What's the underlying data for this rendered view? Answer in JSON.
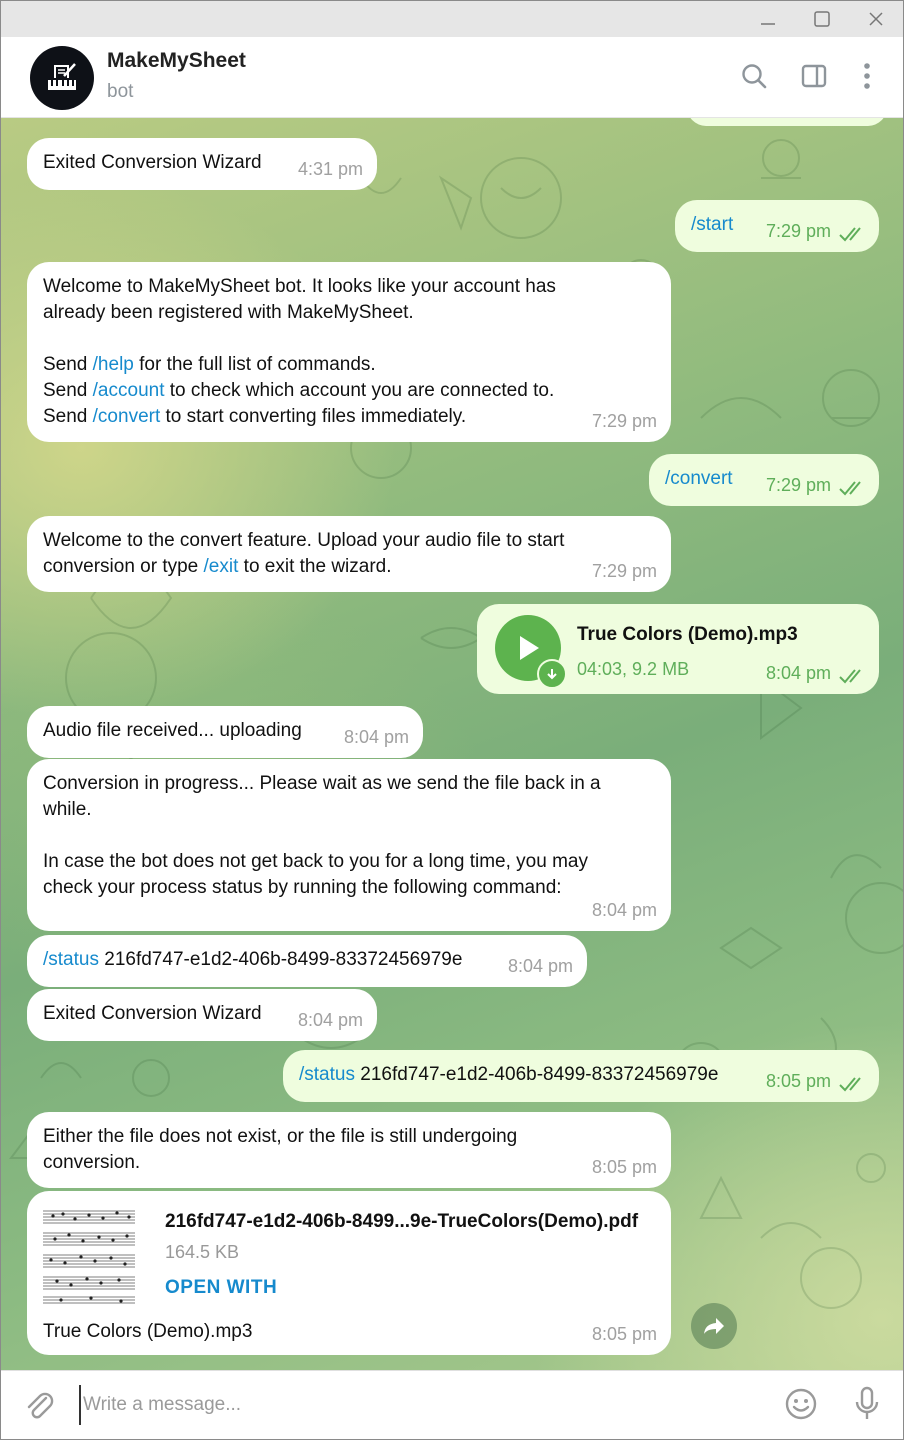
{
  "header": {
    "name": "MakeMySheet",
    "status": "bot"
  },
  "icons": {
    "search": "search-icon",
    "panel": "sidebar-toggle-icon",
    "more": "more-vertical-icon",
    "attach": "paperclip-icon",
    "emoji": "emoji-icon",
    "mic": "microphone-icon",
    "forward": "forward-icon"
  },
  "colors": {
    "accent": "#168acd",
    "outgoing_bubble": "#effdde",
    "outgoing_time": "#5fae5a",
    "play_button": "#5db34e"
  },
  "messages": [
    {
      "id": "m1",
      "text": "Exited Conversion Wizard",
      "time": "4:31 pm"
    },
    {
      "id": "m2",
      "text": "/start",
      "time": "7:29 pm"
    },
    {
      "id": "m3",
      "line1": "Welcome to MakeMySheet bot. It looks like your account has",
      "line2": "already been registered with MakeMySheet.",
      "send": "Send",
      "help": "/help",
      "help_rest": " for the full list of commands.",
      "account": "/account",
      "account_rest": " to check which account you are connected to.",
      "convert": "/convert",
      "convert_rest": " to start converting files immediately.",
      "time": "7:29 pm"
    },
    {
      "id": "m4",
      "text": "/convert",
      "time": "7:29 pm"
    },
    {
      "id": "m5",
      "line1": "Welcome to the convert feature. Upload your audio file to start",
      "line2a": "conversion or type ",
      "exit": "/exit",
      "line2b": " to exit the wizard.",
      "time": "7:29 pm"
    },
    {
      "id": "m6",
      "file_name": "True Colors (Demo).mp3",
      "meta": "04:03, 9.2 MB",
      "time": "8:04 pm"
    },
    {
      "id": "m7",
      "text": "Audio file received... uploading",
      "time": "8:04 pm"
    },
    {
      "id": "m8",
      "line1": "Conversion in progress... Please wait as we send the file back in a",
      "line2": "while.",
      "line3": "In case the bot does not get back to you for a long time, you may",
      "line4": "check your process status by running the following command:",
      "time": "8:04 pm"
    },
    {
      "id": "m9",
      "cmd": "/status",
      "arg": " 216fd747-e1d2-406b-8499-83372456979e",
      "time": "8:04 pm"
    },
    {
      "id": "m10",
      "text": "Exited Conversion Wizard",
      "time": "8:04 pm"
    },
    {
      "id": "m11",
      "cmd": "/status",
      "arg": " 216fd747-e1d2-406b-8499-83372456979e",
      "time": "8:05 pm"
    },
    {
      "id": "m12",
      "line1": "Either the file does not exist, or the file is still undergoing",
      "line2": "conversion.",
      "time": "8:05 pm"
    },
    {
      "id": "m13",
      "file_name": "216fd747-e1d2-406b-8499...9e-TrueColors(Demo).pdf",
      "size": "164.5 KB",
      "action": "OPEN WITH",
      "caption": "True Colors (Demo).mp3",
      "time": "8:05 pm"
    }
  ],
  "composer": {
    "placeholder": "Write a message..."
  }
}
